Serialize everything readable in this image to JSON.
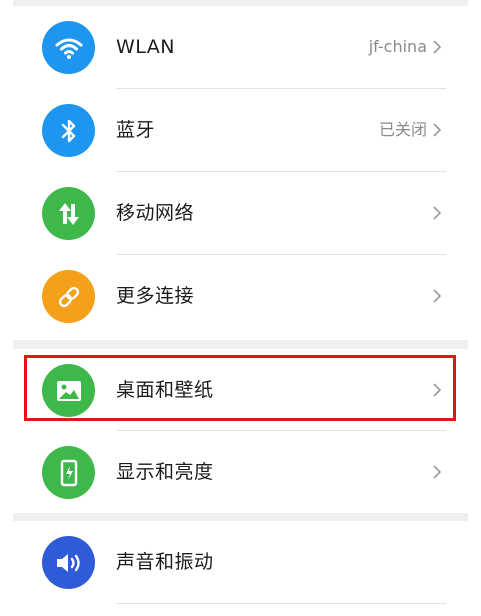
{
  "settings": {
    "items": [
      {
        "label": "WLAN",
        "value": "jf-china",
        "icon": "wifi-icon",
        "icon_color": "#1e96f0"
      },
      {
        "label": "蓝牙",
        "value": "已关闭",
        "icon": "bluetooth-icon",
        "icon_color": "#1e96f0"
      },
      {
        "label": "移动网络",
        "value": "",
        "icon": "mobile-data-icon",
        "icon_color": "#3fb84b"
      },
      {
        "label": "更多连接",
        "value": "",
        "icon": "link-icon",
        "icon_color": "#f5a01a"
      },
      {
        "label": "桌面和壁纸",
        "value": "",
        "icon": "wallpaper-icon",
        "icon_color": "#3fb84b"
      },
      {
        "label": "显示和亮度",
        "value": "",
        "icon": "display-icon",
        "icon_color": "#3fb84b"
      },
      {
        "label": "声音和振动",
        "value": "",
        "icon": "sound-icon",
        "icon_color": "#2f5bd8"
      }
    ]
  },
  "highlight": {
    "color": "#e01515",
    "target": "桌面和壁纸"
  }
}
